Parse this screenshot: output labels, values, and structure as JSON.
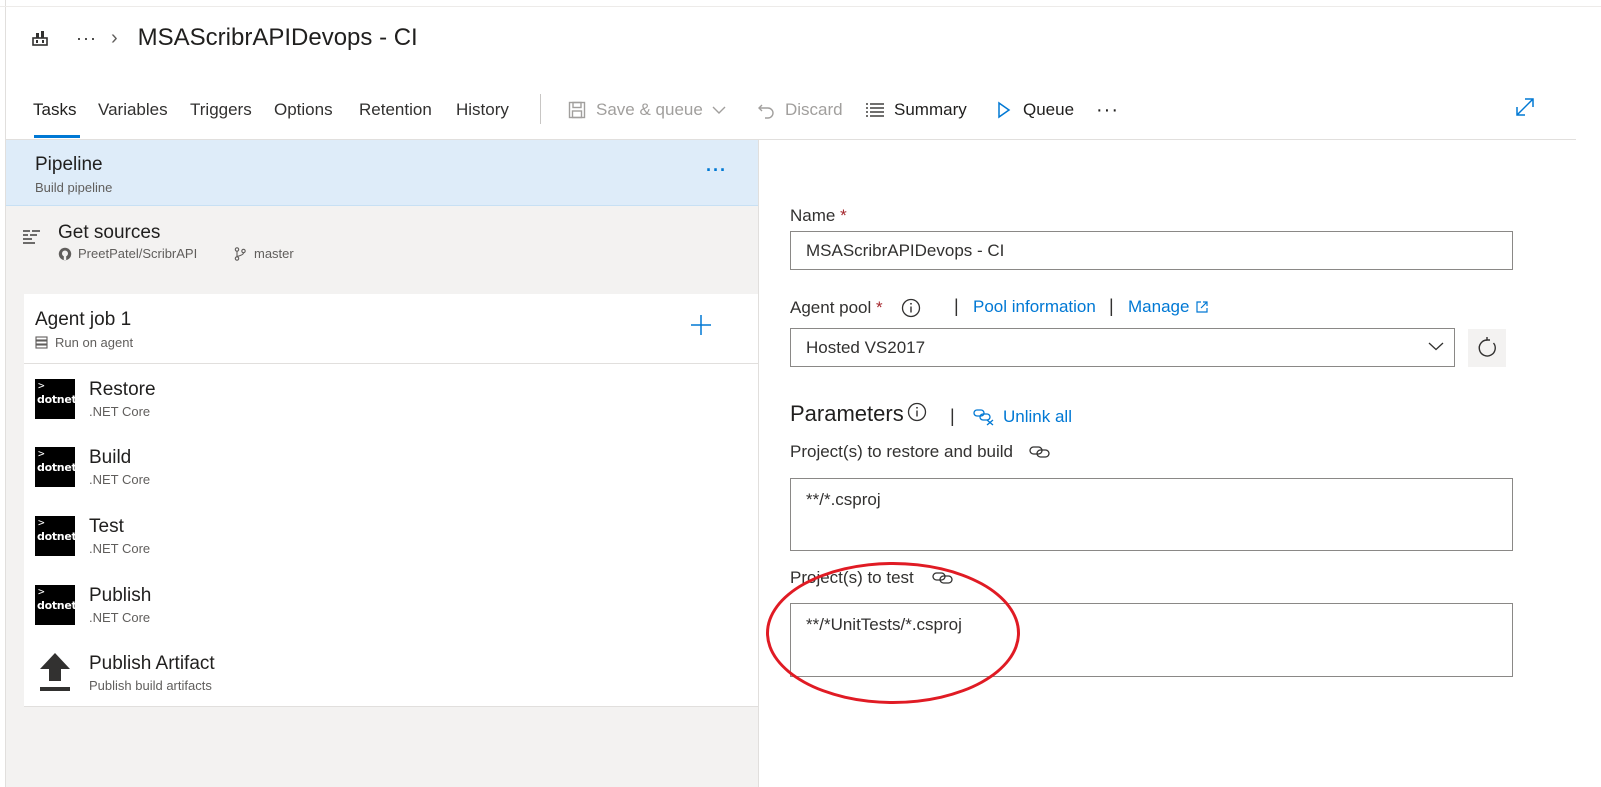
{
  "header": {
    "more": "···",
    "separator": "›",
    "title": "MSAScribrAPIDevops - CI"
  },
  "tabs": [
    {
      "label": "Tasks",
      "active": true
    },
    {
      "label": "Variables"
    },
    {
      "label": "Triggers"
    },
    {
      "label": "Options"
    },
    {
      "label": "Retention"
    },
    {
      "label": "History"
    }
  ],
  "toolbar": {
    "save_queue": "Save & queue",
    "discard": "Discard",
    "summary": "Summary",
    "queue": "Queue",
    "more": "···"
  },
  "pipeline": {
    "title": "Pipeline",
    "subtitle": "Build pipeline",
    "more": "···"
  },
  "get_sources": {
    "title": "Get sources",
    "repo": "PreetPatel/ScribrAPI",
    "branch": "master"
  },
  "agent_job": {
    "title": "Agent job 1",
    "subtitle": "Run on agent"
  },
  "tasks": [
    {
      "name": "Restore",
      "type": ".NET Core",
      "icon_label": "dotnet"
    },
    {
      "name": "Build",
      "type": ".NET Core",
      "icon_label": "dotnet"
    },
    {
      "name": "Test",
      "type": ".NET Core",
      "icon_label": "dotnet"
    },
    {
      "name": "Publish",
      "type": ".NET Core",
      "icon_label": "dotnet"
    },
    {
      "name": "Publish Artifact",
      "type": "Publish build artifacts",
      "icon": "upload-icon"
    }
  ],
  "form": {
    "name_label": "Name",
    "name_value": "MSAScribrAPIDevops - CI",
    "agent_pool_label": "Agent pool",
    "pool_information": "Pool information",
    "manage": "Manage",
    "agent_pool_value": "Hosted VS2017",
    "required_mark": "*",
    "separator": "|",
    "parameters_title": "Parameters",
    "unlink_all": "Unlink all",
    "restore_build_label": "Project(s) to restore and build",
    "restore_build_value": "**/*.csproj",
    "test_label": "Project(s) to test",
    "test_value": "**/*UnitTests/*.csproj"
  },
  "colors": {
    "accent": "#0078d4",
    "selected_row": "#deecf9",
    "required": "#a4262c",
    "annotation": "#e01b24"
  }
}
